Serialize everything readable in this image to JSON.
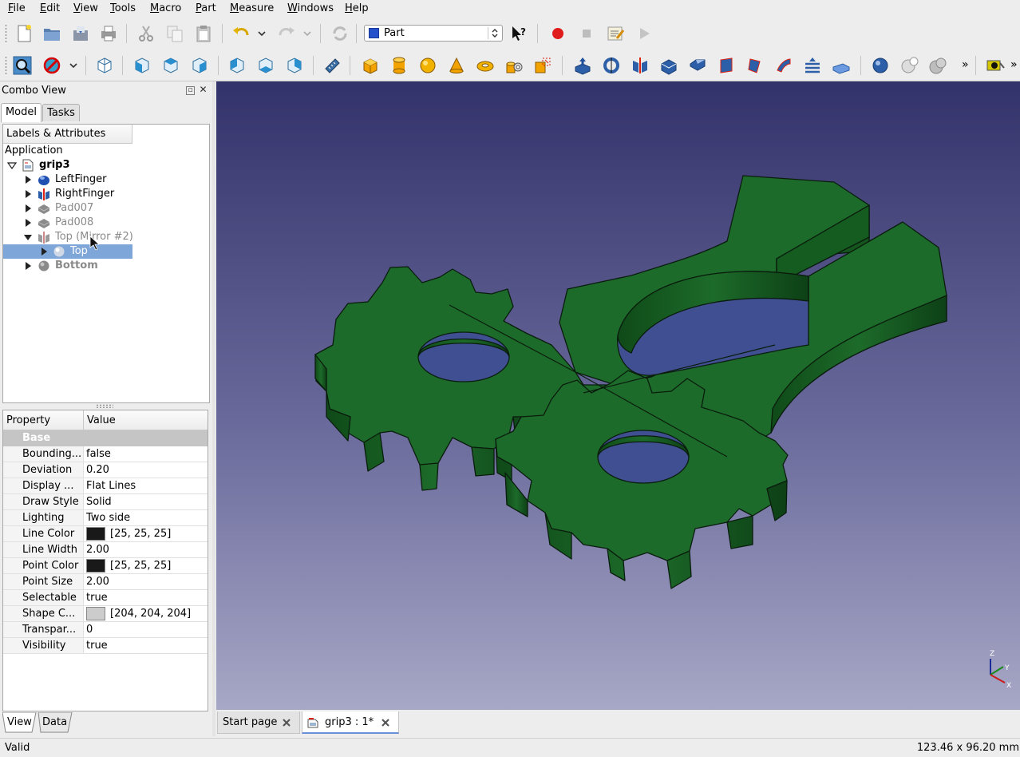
{
  "menu": {
    "items": [
      "File",
      "Edit",
      "View",
      "Tools",
      "Macro",
      "Part",
      "Measure",
      "Windows",
      "Help"
    ]
  },
  "toolbar": {
    "workbench": "Part",
    "icons_row1": [
      "new-icon",
      "open-icon",
      "save-icon",
      "print-icon",
      "cut-icon",
      "copy-icon",
      "paste-icon",
      "undo-icon",
      "redo-icon",
      "refresh-icon",
      "whats-this-icon",
      "record-macro-icon",
      "stop-macro-icon",
      "edit-macro-icon",
      "run-macro-icon"
    ],
    "icons_row2": [
      "fit-all-icon",
      "draw-style-icon",
      "axonometric-icon",
      "front-view-icon",
      "top-view-icon",
      "right-view-icon",
      "rear-view-icon",
      "bottom-view-icon",
      "left-view-icon",
      "measure-icon",
      "box-icon",
      "cylinder-icon",
      "sphere-icon",
      "cone-icon",
      "torus-icon",
      "tube-icon",
      "primitives-icon",
      "shape-builder-icon",
      "extrude-icon",
      "revolve-icon",
      "mirror-icon",
      "fillet-icon",
      "chamfer-icon",
      "make-face-icon",
      "ruled-surface-icon",
      "loft-icon",
      "sweep-icon",
      "section-icon",
      "offset-icon",
      "boolean-icon",
      "cut-icon",
      "union-icon",
      "overflow-icon",
      "check-geometry-icon",
      "overflow2-icon"
    ]
  },
  "combo_view": {
    "title": "Combo View",
    "tabs": [
      "Model",
      "Tasks"
    ],
    "tree_header": "Labels & Attributes",
    "root_label": "Application",
    "document": "grip3",
    "items": [
      {
        "label": "LeftFinger",
        "icon": "solid-body-icon",
        "color": "#2a52be",
        "visible": true
      },
      {
        "label": "RightFinger",
        "icon": "mirror-icon",
        "color": "#3a5fcd",
        "visible": true
      },
      {
        "label": "Pad007",
        "icon": "pad-icon",
        "color": "#888888",
        "visible": false
      },
      {
        "label": "Pad008",
        "icon": "pad-icon",
        "color": "#888888",
        "visible": false
      },
      {
        "label": "Top (Mirror #2)",
        "icon": "mirror-icon",
        "color": "#999999",
        "visible": false
      },
      {
        "label": "Top",
        "icon": "sphere-icon",
        "color": "#cccccc",
        "visible": false,
        "selected": true
      },
      {
        "label": "Bottom",
        "icon": "sphere-icon",
        "color": "#888888",
        "visible": false
      }
    ]
  },
  "properties": {
    "headers": [
      "Property",
      "Value"
    ],
    "group": "Base",
    "rows": [
      {
        "name": "Bounding...",
        "value": "false"
      },
      {
        "name": "Deviation",
        "value": "0.20"
      },
      {
        "name": "Display ...",
        "value": "Flat Lines"
      },
      {
        "name": "Draw Style",
        "value": "Solid"
      },
      {
        "name": "Lighting",
        "value": "Two side"
      },
      {
        "name": "Line Color",
        "value": "[25, 25, 25]",
        "swatch": "#191919"
      },
      {
        "name": "Line Width",
        "value": "2.00"
      },
      {
        "name": "Point Color",
        "value": "[25, 25, 25]",
        "swatch": "#191919"
      },
      {
        "name": "Point Size",
        "value": "2.00"
      },
      {
        "name": "Selectable",
        "value": "true"
      },
      {
        "name": "Shape C...",
        "value": "[204, 204, 204]",
        "swatch": "#cccccc"
      },
      {
        "name": "Transpar...",
        "value": "0"
      },
      {
        "name": "Visibility",
        "value": "true"
      }
    ],
    "tabs": [
      "View",
      "Data"
    ]
  },
  "viewport": {
    "axis_labels": {
      "z": "Z",
      "y": "Y",
      "x": "X"
    },
    "model_color": "#1d6b2a"
  },
  "doc_tabs": [
    {
      "label": "Start page"
    },
    {
      "label": "grip3 : 1*"
    }
  ],
  "status": {
    "message": "Valid",
    "dimensions": "123.46 x 96.20 mm"
  }
}
